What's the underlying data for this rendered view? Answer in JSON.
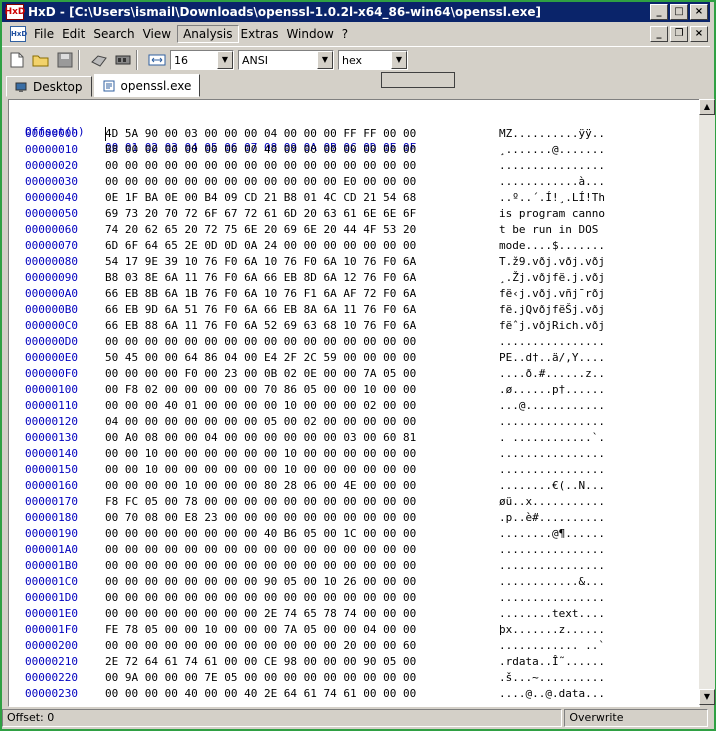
{
  "window": {
    "app_name": "HxD",
    "title": "HxD - [C:\\Users\\ismail\\Downloads\\openssl-1.0.2l-x64_86-win64\\openssl.exe]",
    "min_glyph": "_",
    "max_glyph": "□",
    "close_glyph": "×",
    "restore_glyph": "❐"
  },
  "menu": {
    "items": [
      "File",
      "Edit",
      "Search",
      "View",
      "Analysis",
      "Extras",
      "Window",
      "?"
    ]
  },
  "toolbar": {
    "bytes_per_row": "16",
    "charset": "ANSI",
    "offset_base": "hex"
  },
  "tabs": [
    {
      "label": "Desktop"
    },
    {
      "label": "openssl.exe"
    }
  ],
  "hex": {
    "header_offset": "Offset(h)",
    "header_columns": "00 01 02 03 04 05 06 07 08 09 0A 0B 0C 0D 0E 0F",
    "rows": [
      {
        "offset": "00000000",
        "bytes": "4D 5A 90 00 03 00 00 00 04 00 00 00 FF FF 00 00",
        "ascii": "MZ..........ÿÿ.."
      },
      {
        "offset": "00000010",
        "bytes": "B8 00 00 00 00 00 00 00 40 00 00 00 00 00 00 00",
        "ascii": "¸.......@......."
      },
      {
        "offset": "00000020",
        "bytes": "00 00 00 00 00 00 00 00 00 00 00 00 00 00 00 00",
        "ascii": "................"
      },
      {
        "offset": "00000030",
        "bytes": "00 00 00 00 00 00 00 00 00 00 00 00 E0 00 00 00",
        "ascii": "............à..."
      },
      {
        "offset": "00000040",
        "bytes": "0E 1F BA 0E 00 B4 09 CD 21 B8 01 4C CD 21 54 68",
        "ascii": "..º..´.Í!¸.LÍ!Th"
      },
      {
        "offset": "00000050",
        "bytes": "69 73 20 70 72 6F 67 72 61 6D 20 63 61 6E 6E 6F",
        "ascii": "is program canno"
      },
      {
        "offset": "00000060",
        "bytes": "74 20 62 65 20 72 75 6E 20 69 6E 20 44 4F 53 20",
        "ascii": "t be run in DOS "
      },
      {
        "offset": "00000070",
        "bytes": "6D 6F 64 65 2E 0D 0D 0A 24 00 00 00 00 00 00 00",
        "ascii": "mode....$......."
      },
      {
        "offset": "00000080",
        "bytes": "54 17 9E 39 10 76 F0 6A 10 76 F0 6A 10 76 F0 6A",
        "ascii": "T.ž9.vðj.vðj.vðj"
      },
      {
        "offset": "00000090",
        "bytes": "B8 03 8E 6A 11 76 F0 6A 66 EB 8D 6A 12 76 F0 6A",
        "ascii": "¸.Žj.vðjfë.j.vðj"
      },
      {
        "offset": "000000A0",
        "bytes": "66 EB 8B 6A 1B 76 F0 6A 10 76 F1 6A AF 72 F0 6A",
        "ascii": "fë‹j.vðj.vñj¯rðj"
      },
      {
        "offset": "000000B0",
        "bytes": "66 EB 9D 6A 51 76 F0 6A 66 EB 8A 6A 11 76 F0 6A",
        "ascii": "fë.jQvðjfëŠj.vðj"
      },
      {
        "offset": "000000C0",
        "bytes": "66 EB 88 6A 11 76 F0 6A 52 69 63 68 10 76 F0 6A",
        "ascii": "fëˆj.vðjRich.vðj"
      },
      {
        "offset": "000000D0",
        "bytes": "00 00 00 00 00 00 00 00 00 00 00 00 00 00 00 00",
        "ascii": "................"
      },
      {
        "offset": "000000E0",
        "bytes": "50 45 00 00 64 86 04 00 E4 2F 2C 59 00 00 00 00",
        "ascii": "PE..d†..ä/,Y...."
      },
      {
        "offset": "000000F0",
        "bytes": "00 00 00 00 F0 00 23 00 0B 02 0E 00 00 7A 05 00",
        "ascii": "....ð.#......z.."
      },
      {
        "offset": "00000100",
        "bytes": "00 F8 02 00 00 00 00 00 70 86 05 00 00 10 00 00",
        "ascii": ".ø......p†......"
      },
      {
        "offset": "00000110",
        "bytes": "00 00 00 40 01 00 00 00 00 10 00 00 00 02 00 00",
        "ascii": "...@............"
      },
      {
        "offset": "00000120",
        "bytes": "04 00 00 00 00 00 00 00 05 00 02 00 00 00 00 00",
        "ascii": "................"
      },
      {
        "offset": "00000130",
        "bytes": "00 A0 08 00 00 04 00 00 00 00 00 00 03 00 60 81",
        "ascii": ". ............`."
      },
      {
        "offset": "00000140",
        "bytes": "00 00 10 00 00 00 00 00 00 10 00 00 00 00 00 00",
        "ascii": "................"
      },
      {
        "offset": "00000150",
        "bytes": "00 00 10 00 00 00 00 00 00 10 00 00 00 00 00 00",
        "ascii": "................"
      },
      {
        "offset": "00000160",
        "bytes": "00 00 00 00 10 00 00 00 80 28 06 00 4E 00 00 00",
        "ascii": "........€(..N..."
      },
      {
        "offset": "00000170",
        "bytes": "F8 FC 05 00 78 00 00 00 00 00 00 00 00 00 00 00",
        "ascii": "øü..x..........."
      },
      {
        "offset": "00000180",
        "bytes": "00 70 08 00 E8 23 00 00 00 00 00 00 00 00 00 00",
        "ascii": ".p..è#.........."
      },
      {
        "offset": "00000190",
        "bytes": "00 00 00 00 00 00 00 00 40 B6 05 00 1C 00 00 00",
        "ascii": "........@¶......"
      },
      {
        "offset": "000001A0",
        "bytes": "00 00 00 00 00 00 00 00 00 00 00 00 00 00 00 00",
        "ascii": "................"
      },
      {
        "offset": "000001B0",
        "bytes": "00 00 00 00 00 00 00 00 00 00 00 00 00 00 00 00",
        "ascii": "................"
      },
      {
        "offset": "000001C0",
        "bytes": "00 00 00 00 00 00 00 00 90 05 00 10 26 00 00 00",
        "ascii": "............&..."
      },
      {
        "offset": "000001D0",
        "bytes": "00 00 00 00 00 00 00 00 00 00 00 00 00 00 00 00",
        "ascii": "................"
      },
      {
        "offset": "000001E0",
        "bytes": "00 00 00 00 00 00 00 00 2E 74 65 78 74 00 00 00",
        "ascii": "........text...."
      },
      {
        "offset": "000001F0",
        "bytes": "FE 78 05 00 00 10 00 00 00 7A 05 00 00 04 00 00",
        "ascii": "þx.......z......"
      },
      {
        "offset": "00000200",
        "bytes": "00 00 00 00 00 00 00 00 00 00 00 00 20 00 00 60",
        "ascii": "............ ..`"
      },
      {
        "offset": "00000210",
        "bytes": "2E 72 64 61 74 61 00 00 CE 98 00 00 00 90 05 00",
        "ascii": ".rdata..Î˜......"
      },
      {
        "offset": "00000220",
        "bytes": "00 9A 00 00 00 7E 05 00 00 00 00 00 00 00 00 00",
        "ascii": ".š...~.........."
      },
      {
        "offset": "00000230",
        "bytes": "00 00 00 00 40 00 00 40 2E 64 61 74 61 00 00 00",
        "ascii": "....@..@.data..."
      }
    ]
  },
  "status": {
    "offset": "Offset: 0",
    "mode": "Overwrite"
  }
}
